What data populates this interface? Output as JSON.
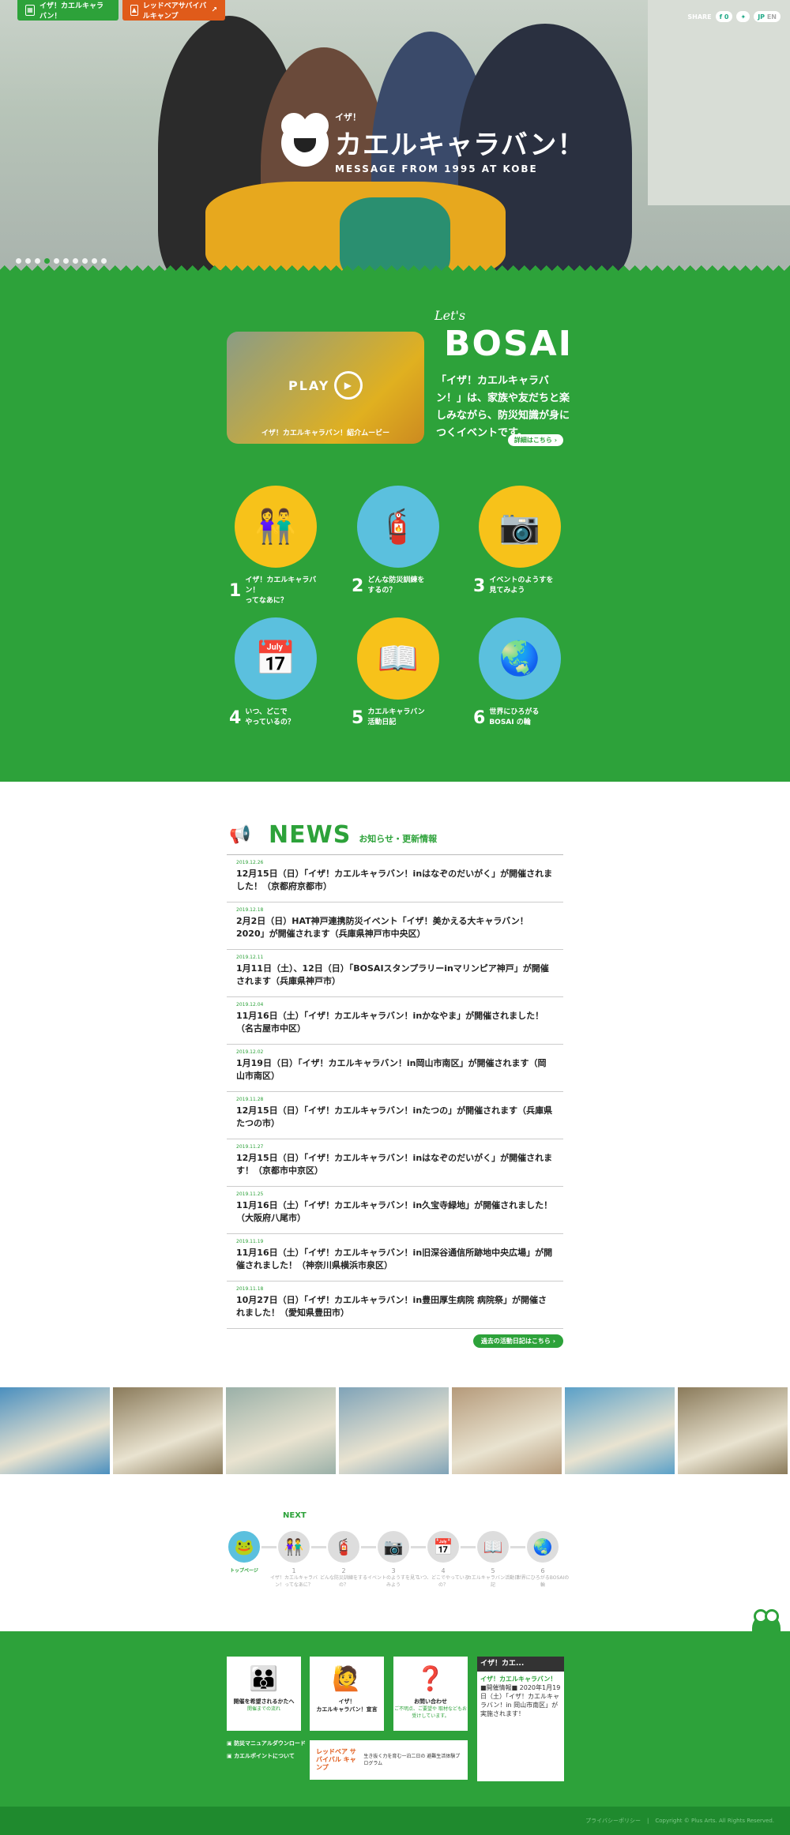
{
  "top_tabs": [
    {
      "label": "イザ！カエルキャラバン！",
      "color": "#2da23a"
    },
    {
      "label": "レッドベアサバイバルキャンプ",
      "color": "#e05b1a"
    }
  ],
  "share": {
    "label": "SHARE",
    "fb_count": "0",
    "lang_jp": "JP",
    "lang_en": "EN"
  },
  "hero": {
    "logo_prefix": "イザ！",
    "logo_title": "カエルキャラバン！",
    "logo_sub": "MESSAGE FROM 1995 AT KOBE",
    "slide_count": 10,
    "active_slide": 3
  },
  "intro": {
    "lets": "Let's",
    "bosai": "BOSAI",
    "text": "「イザ！カエルキャラバン！」は、家族や友だちと楽しみながら、防災知識が身につくイベントです。",
    "more": "詳細はこちら",
    "video_play": "PLAY",
    "video_caption": "イザ！カエルキャラバン！紹介ムービー"
  },
  "categories": [
    {
      "num": "1",
      "text": "イザ！カエルキャラバン！\nってなあに？",
      "icon": "kids-banner-icon",
      "bg": "#f7c21a"
    },
    {
      "num": "2",
      "text": "どんな防災訓練を\nするの？",
      "icon": "drill-icon",
      "bg": "#5bc0de"
    },
    {
      "num": "3",
      "text": "イベントのようすを\n見てみよう",
      "icon": "camera-photos-icon",
      "bg": "#f7c21a"
    },
    {
      "num": "4",
      "text": "いつ、どこで\nやっているの？",
      "icon": "calendar-icon",
      "bg": "#5bc0de"
    },
    {
      "num": "5",
      "text": "カエルキャラバン\n活動日記",
      "icon": "diary-icon",
      "bg": "#f7c21a"
    },
    {
      "num": "6",
      "text": "世界にひろがる\nBOSAI の輪",
      "icon": "globe-icon",
      "bg": "#5bc0de"
    }
  ],
  "news": {
    "title": "NEWS",
    "subtitle": "お知らせ・更新情報",
    "items": [
      {
        "date": "2019.12.26",
        "text": "12月15日（日）「イザ！カエルキャラバン！inはなぞのだいがく」が開催されました！（京都府京都市）"
      },
      {
        "date": "2019.12.18",
        "text": "2月2日（日）HAT神戸連携防災イベント「イザ！美かえる大キャラバン！2020」が開催されます（兵庫県神戸市中央区）"
      },
      {
        "date": "2019.12.11",
        "text": "1月11日（土）、12日（日）「BOSAIスタンプラリーinマリンピア神戸」が開催されます（兵庫県神戸市）"
      },
      {
        "date": "2019.12.04",
        "text": "11月16日（土）「イザ！カエルキャラバン！inかなやま」が開催されました！（名古屋市中区）"
      },
      {
        "date": "2019.12.02",
        "text": "1月19日（日）「イザ！カエルキャラバン！in岡山市南区」が開催されます（岡山市南区）"
      },
      {
        "date": "2019.11.28",
        "text": "12月15日（日）「イザ！カエルキャラバン！inたつの」が開催されます（兵庫県たつの市）"
      },
      {
        "date": "2019.11.27",
        "text": "12月15日（日）「イザ！カエルキャラバン！inはなぞのだいがく」が開催されます！（京都市中京区）"
      },
      {
        "date": "2019.11.25",
        "text": "11月16日（土）「イザ！カエルキャラバン！in久宝寺緑地」が開催されました！（大阪府八尾市）"
      },
      {
        "date": "2019.11.19",
        "text": "11月16日（土）「イザ！カエルキャラバン！in旧深谷通信所跡地中央広場」が開催されました！（神奈川県横浜市泉区）"
      },
      {
        "date": "2019.11.18",
        "text": "10月27日（日）「イザ！カエルキャラバン！in豊田厚生病院 病院祭」が開催されました！（愛知県豊田市）"
      }
    ],
    "archive": "過去の活動日記はこちら"
  },
  "photo_colors": [
    "#4a8fbf",
    "#8a7a5a",
    "#9ab0a8",
    "#7fa3b8",
    "#b59a7a",
    "#5aa0c8",
    "#8a7a5a",
    "#9ab0a8"
  ],
  "pager": {
    "next": "NEXT",
    "items": [
      {
        "num": "",
        "label": "トップページ"
      },
      {
        "num": "1",
        "label": "イザ！カエルキャラバン！ってなあに？"
      },
      {
        "num": "2",
        "label": "どんな防災訓練をするの？"
      },
      {
        "num": "3",
        "label": "イベントのようすを見てみよう"
      },
      {
        "num": "4",
        "label": "いつ、どこでやっているの？"
      },
      {
        "num": "5",
        "label": "カエルキャラバン活動日記"
      },
      {
        "num": "6",
        "label": "世界にひろがるBOSAIの輪"
      }
    ]
  },
  "footer": {
    "cards": [
      {
        "title": "開催を希望されるかたへ",
        "sub": "開催までの流れ",
        "icon": "people-icon"
      },
      {
        "title": "イザ！\nカエルキャラバン！宣言",
        "sub": "",
        "icon": "mascot-icon"
      },
      {
        "title": "お問い合わせ",
        "sub": "ご不明点、ご要望や 取材などもお受けしています。",
        "icon": "question-icon"
      }
    ],
    "links": [
      "防災マニュアルダウンロード",
      "カエルポイントについて"
    ],
    "camp_logo": "レッドベア サバイバル キャンプ",
    "camp_text": "生き抜く力を育む一泊二日の 避難生活体験プログラム",
    "fb_header": "イザ！カエ...",
    "fb_title": "イザ！カエルキャラバン！",
    "fb_body": "■開催情報■ 2020年1月19日（土）「イザ！カエルキャラバン！in 岡山市南区」が実施されます！",
    "copyright": "Copyright © Plus Arts. All Rights Reserved.",
    "privacy": "プライバシーポリシー"
  }
}
